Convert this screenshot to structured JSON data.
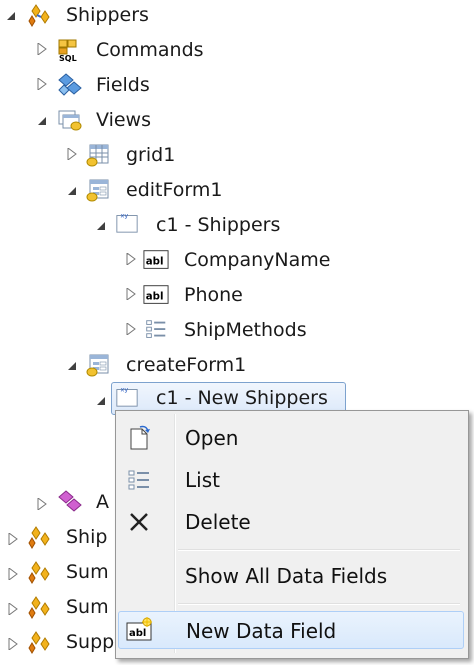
{
  "tree": {
    "shippers": "Shippers",
    "commands": "Commands",
    "fields": "Fields",
    "views": "Views",
    "grid1": "grid1",
    "editForm1": "editForm1",
    "c1_shippers": "c1 - Shippers",
    "company_name": "CompanyName",
    "phone": "Phone",
    "ship_methods": "ShipMethods",
    "createForm1": "createForm1",
    "c1_new_shippers": "c1 - New Shippers",
    "partial_a": "A",
    "partial_ship": "Ship",
    "partial_sum1": "Sum",
    "partial_sum2": "Sum",
    "partial_supp": "Supp"
  },
  "context_menu": {
    "open": "Open",
    "list": "List",
    "delete": "Delete",
    "show_all": "Show All Data Fields",
    "new_data_field": "New Data Field"
  },
  "icons": {
    "table": "table-icon",
    "sql": "sql-commands-icon",
    "fields": "fields-icon",
    "views": "views-icon",
    "grid": "grid-view-icon",
    "form": "form-view-icon",
    "category": "category-icon",
    "textbox": "textbox-field-icon",
    "list": "list-field-icon"
  },
  "colors": {
    "selection_border": "#7da2ce",
    "menu_highlight": "#d9e9fc"
  }
}
